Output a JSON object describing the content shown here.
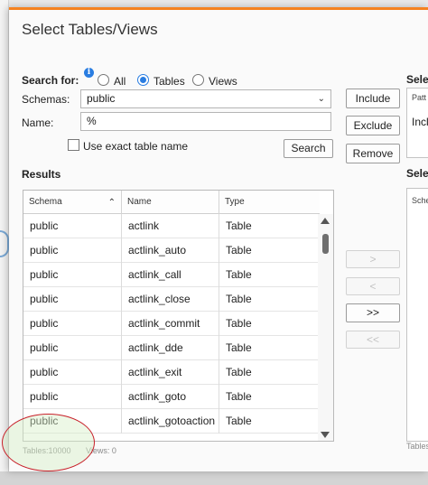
{
  "dialog": {
    "title": "Select Tables/Views"
  },
  "search": {
    "label": "Search for:",
    "options": [
      "All",
      "Tables",
      "Views"
    ],
    "selected": "Tables"
  },
  "schemas": {
    "label": "Schemas:",
    "value": "public"
  },
  "name": {
    "label": "Name:",
    "value": "%"
  },
  "exact_match": {
    "label": "Use exact table name",
    "checked": false
  },
  "buttons": {
    "search": "Search",
    "include": "Include",
    "exclude": "Exclude",
    "remove": "Remove",
    "move_right": ">",
    "move_left": "<",
    "move_all_right": ">>",
    "move_all_left": "<<"
  },
  "results": {
    "label": "Results",
    "columns": [
      "Schema",
      "Name",
      "Type"
    ],
    "rows": [
      [
        "public",
        "actlink",
        "Table"
      ],
      [
        "public",
        "actlink_auto",
        "Table"
      ],
      [
        "public",
        "actlink_call",
        "Table"
      ],
      [
        "public",
        "actlink_close",
        "Table"
      ],
      [
        "public",
        "actlink_commit",
        "Table"
      ],
      [
        "public",
        "actlink_dde",
        "Table"
      ],
      [
        "public",
        "actlink_exit",
        "Table"
      ],
      [
        "public",
        "actlink_goto",
        "Table"
      ],
      [
        "public",
        "actlink_gotoaction",
        "Table"
      ]
    ]
  },
  "status": {
    "tables": "Tables:10000",
    "views": "Views: 0"
  },
  "right_panel": {
    "top_label": "Selec",
    "pattern_header": "Patt",
    "pattern_value": "Incl",
    "bottom_label": "Selec",
    "schema_header": "Sche",
    "status": "Tables"
  },
  "colors": {
    "accent": "#f58220",
    "radio_selected": "#2a7de1",
    "annotation": "#c8202a"
  }
}
